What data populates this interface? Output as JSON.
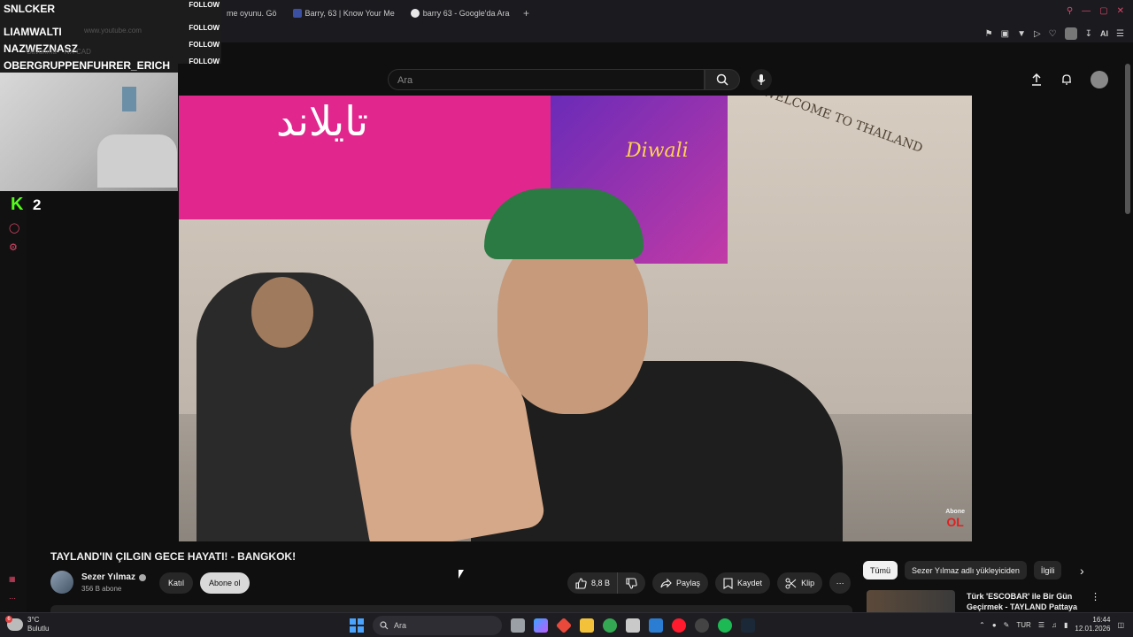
{
  "browser": {
    "tabs": [
      {
        "label": "me oyunu. Gö"
      },
      {
        "label": "Barry, 63 | Know Your Me"
      },
      {
        "label": "barry 63 - Google'da Ara"
      }
    ],
    "new_tab_symbol": "+",
    "ai_label": "AI"
  },
  "overlay": {
    "followers": [
      {
        "name": "SNLCKER",
        "follow": "FOLLOW"
      },
      {
        "name": "LIAMWALTI",
        "follow": "FOLLOW"
      },
      {
        "name": "NAZWEZNASZ",
        "follow": "FOLLOW"
      },
      {
        "name": "OBERGRUPPENFUHRER_ERICH",
        "follow": "FOLLOW"
      }
    ],
    "url_ghost": "www.youtube.com",
    "bookmark_ghost": "Savunma",
    "bookmark_ghost2": "NX CAD",
    "kick_logo": "K",
    "kick_count": "2"
  },
  "youtube": {
    "search_placeholder": "Ara",
    "video": {
      "overlay_text": "تايلاند",
      "banner_text": "Diwali",
      "sign_text": "WELCOME TO THAILAND",
      "watermark_small": "Abone",
      "watermark_big": "OL"
    },
    "title": "TAYLAND'IN ÇILGIN GECE HAYATI! - BANGKOK!",
    "channel": {
      "name": "Sezer Yılmaz",
      "subscribers": "356 B abone"
    },
    "join_label": "Katıl",
    "subscribe_label": "Abone ol",
    "actions": {
      "likes": "8,8 B",
      "share": "Paylaş",
      "save": "Kaydet",
      "clip": "Klip"
    },
    "chips": [
      {
        "label": "Tümü",
        "active": true
      },
      {
        "label": "Sezer Yılmaz adlı yükleyiciden",
        "active": false
      },
      {
        "label": "İlgili",
        "active": false
      }
    ],
    "recommendation": {
      "title": "Türk 'ESCOBAR' ile Bir Gün Geçirmek - TAYLAND Pattaya"
    }
  },
  "taskbar": {
    "weather": {
      "temp": "3°C",
      "condition": "Bulutlu",
      "badge": "6"
    },
    "search_placeholder": "Ara",
    "language": "TUR",
    "time": "16:44",
    "date": "12.01.2026"
  },
  "colors": {
    "accent": "#e0486a",
    "kick": "#53fc18",
    "background": "#0f0f0f"
  }
}
